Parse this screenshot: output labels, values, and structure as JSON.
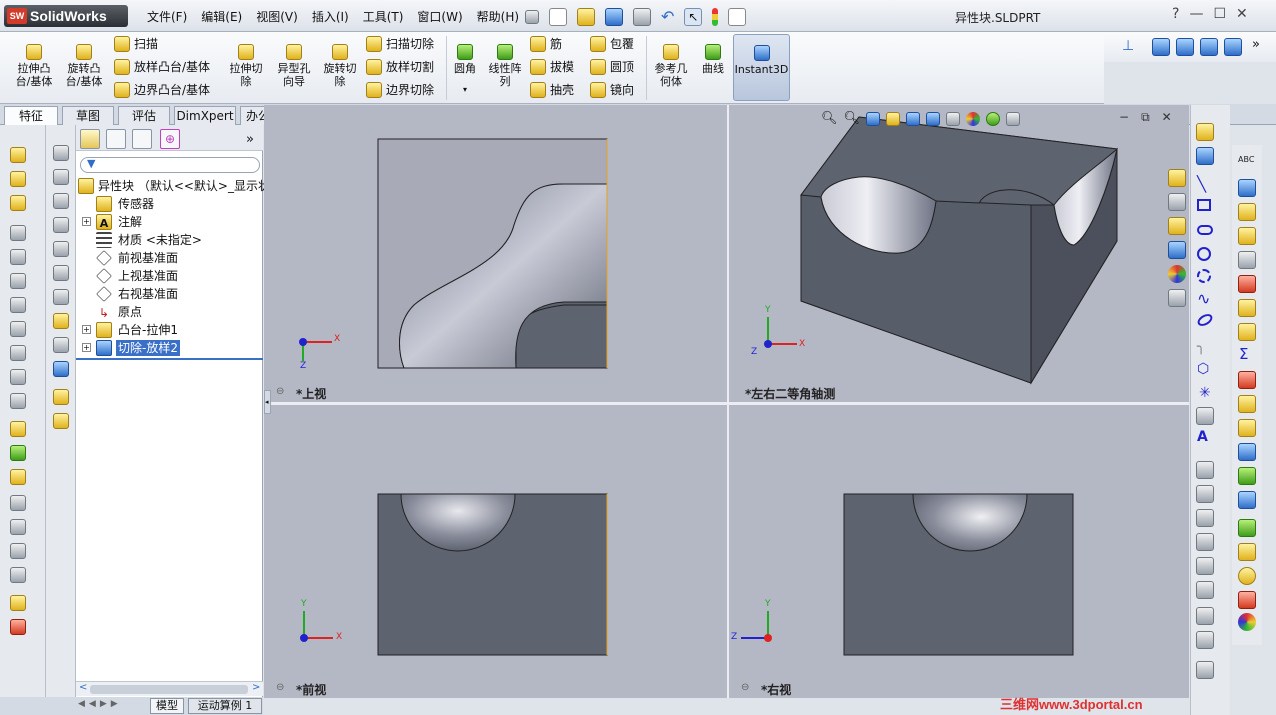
{
  "app": {
    "name": "SolidWorks",
    "logo_badge": "SW",
    "document_title": "异性块.SLDPRT"
  },
  "menu": [
    "文件(F)",
    "编辑(E)",
    "视图(V)",
    "插入(I)",
    "工具(T)",
    "窗口(W)",
    "帮助(H)"
  ],
  "window_controls": {
    "help": "?",
    "minimize": "—",
    "restore": "☐",
    "close": "✕"
  },
  "command_manager": {
    "extrude_boss": "拉伸凸\n台/基体",
    "revolve_boss": "旋转凸\n台/基体",
    "sweep": "扫描",
    "loft_boss": "放样凸台/基体",
    "boundary_boss": "边界凸台/基体",
    "extrude_cut": "拉伸切\n除",
    "hole_wizard": "异型孔\n向导",
    "revolve_cut": "旋转切\n除",
    "sweep_cut": "扫描切除",
    "loft_cut": "放样切割",
    "boundary_cut": "边界切除",
    "fillet": "圆角",
    "linear_pattern": "线性阵\n列",
    "rib": "筋",
    "draft": "拔模",
    "shell": "抽壳",
    "wrap": "包覆",
    "dome": "圆顶",
    "mirror": "镜向",
    "ref_geometry": "参考几\n何体",
    "curves": "曲线",
    "instant3d": "Instant3D"
  },
  "tabs": [
    "特征",
    "草图",
    "评估",
    "DimXpert",
    "办公室产品"
  ],
  "active_tab": "特征",
  "tree": {
    "root": "异性块 （默认<<默认>_显示状",
    "items": [
      "传感器",
      "注解",
      "材质 <未指定>",
      "前视基准面",
      "上视基准面",
      "右视基准面",
      "原点",
      "凸台-拉伸1",
      "切除-放样2"
    ]
  },
  "bottom_tabs": [
    "模型",
    "运动算例 1"
  ],
  "viewports": {
    "top": "*上视",
    "iso": "*左右二等角轴测",
    "front": "*前视",
    "right": "*右视"
  },
  "axes": {
    "x": "X",
    "y": "Y",
    "z": "Z"
  },
  "watermark": "三维网www.3dportal.cn",
  "colors": {
    "viewport_bg": "#b4b7c4",
    "part_gray": "#5e6370",
    "highlight": "#2f6fc9"
  }
}
